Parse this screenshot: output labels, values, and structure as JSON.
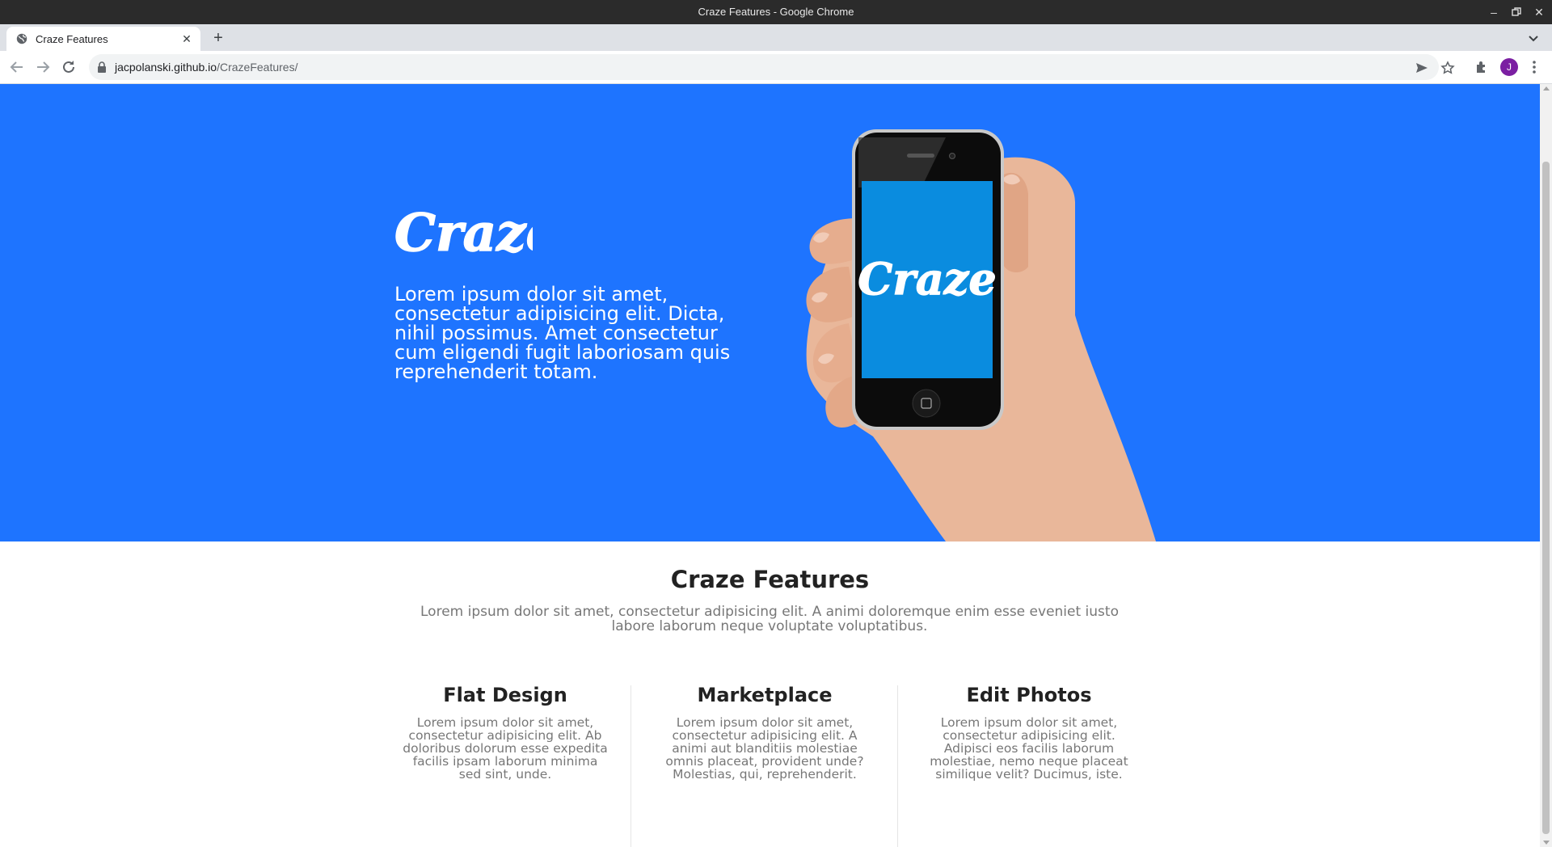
{
  "window": {
    "title": "Craze Features - Google Chrome"
  },
  "tab": {
    "title": "Craze Features"
  },
  "toolbar": {
    "url_host": "jacpolanski.github.io",
    "url_path": "/CrazeFeatures/",
    "avatar_letter": "J"
  },
  "hero": {
    "logo_text": "Craze",
    "phone_logo_text": "Craze",
    "text": "Lorem ipsum dolor sit amet, consectetur adipisicing elit. Dicta, nihil possimus. Amet consectetur cum eligendi fugit laboriosam quis reprehenderit totam.",
    "background_color": "#1e74ff"
  },
  "features": {
    "title": "Craze Features",
    "subtitle": "Lorem ipsum dolor sit amet, consectetur adipisicing elit. A animi doloremque enim esse eveniet iusto labore laborum neque voluptate voluptatibus.",
    "columns": [
      {
        "heading": "Flat Design",
        "text": "Lorem ipsum dolor sit amet, consectetur adipisicing elit. Ab doloribus dolorum esse expedita facilis ipsam laborum minima sed sint, unde."
      },
      {
        "heading": "Marketplace",
        "text": "Lorem ipsum dolor sit amet, consectetur adipisicing elit. A animi aut blanditiis molestiae omnis placeat, provident unde? Molestias, qui, reprehenderit."
      },
      {
        "heading": "Edit Photos",
        "text": "Lorem ipsum dolor sit amet, consectetur adipisicing elit. Adipisci eos facilis laborum molestiae, nemo neque placeat similique velit? Ducimus, iste."
      }
    ]
  },
  "icons": {
    "favicon": "globe-icon",
    "back": "arrow-left-icon",
    "forward": "arrow-right-icon",
    "reload": "reload-icon",
    "lock": "lock-icon",
    "send": "send-icon",
    "star": "star-icon",
    "extensions": "puzzle-icon",
    "menu": "kebab-menu-icon"
  }
}
